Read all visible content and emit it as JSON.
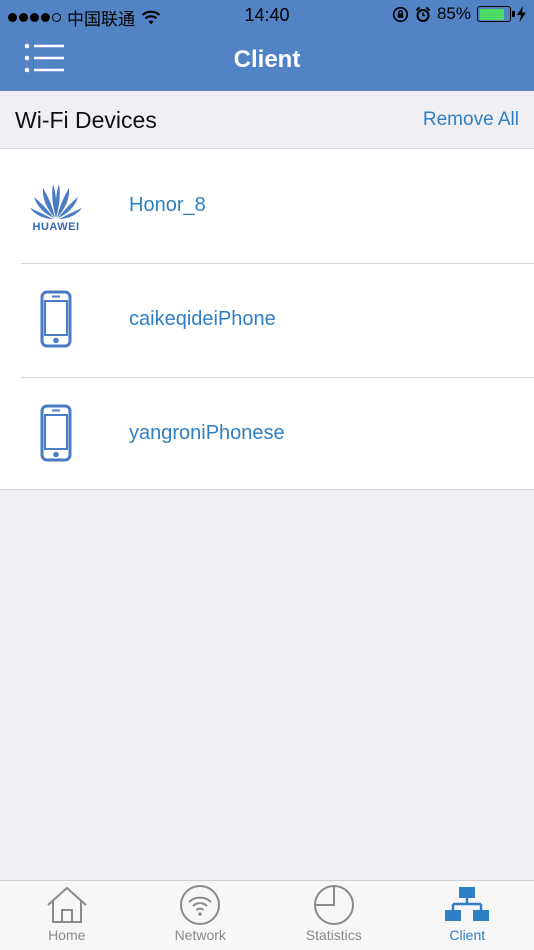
{
  "status_bar": {
    "carrier": "中国联通",
    "time": "14:40",
    "battery": "85%",
    "battery_level": 0.85
  },
  "nav": {
    "title": "Client"
  },
  "section": {
    "title": "Wi-Fi Devices",
    "action_label": "Remove All"
  },
  "devices": [
    {
      "name": "Honor_8",
      "icon": "huawei-logo-icon",
      "brand_text": "HUAWEI"
    },
    {
      "name": "caikeqideiPhone",
      "icon": "phone-icon"
    },
    {
      "name": "yangroniPhonese",
      "icon": "phone-icon"
    }
  ],
  "tabs": [
    {
      "label": "Home",
      "icon": "home-icon",
      "active": false
    },
    {
      "label": "Network",
      "icon": "wifi-icon",
      "active": false
    },
    {
      "label": "Statistics",
      "icon": "pie-chart-icon",
      "active": false
    },
    {
      "label": "Client",
      "icon": "network-topology-icon",
      "active": true
    }
  ],
  "colors": {
    "header": "#5283c4",
    "accent": "#2f7fc4",
    "background": "#efeff4",
    "battery": "#4cd964"
  }
}
